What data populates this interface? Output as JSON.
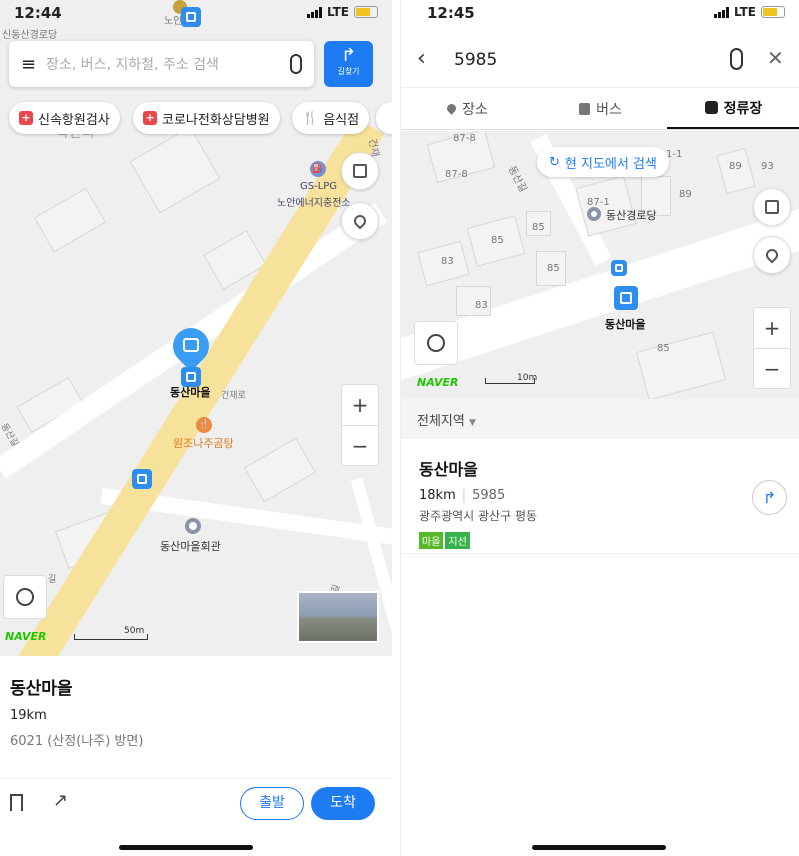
{
  "left": {
    "status": {
      "time": "12:44",
      "network": "LTE"
    },
    "search": {
      "placeholder": "장소, 버스, 지하철, 주소 검색",
      "directions_label": "길찾기"
    },
    "chips": [
      "신속항원검사",
      "코로나전화상담병원",
      "음식점"
    ],
    "map_labels": {
      "top_place": "노안",
      "dongsan_hall_top": "신동산경로당",
      "area": "학산리",
      "gas_name": "GS-LPG",
      "gas_sub": "노안에너지충전소",
      "stop": "동산마을",
      "road": "건재로",
      "restaurant": "원조나주곰탕",
      "hall": "동산마을회관",
      "road_side": "학산동산길",
      "road_left": "동산길",
      "road_left2": "길",
      "road_top_right": "건재"
    },
    "naver_logo": "NAVER",
    "scale_label": "50m",
    "card": {
      "title": "동산마을",
      "distance": "19km",
      "direction": "6021 (산정(나주) 방면)"
    },
    "buttons": {
      "depart": "출발",
      "arrive": "도착"
    }
  },
  "right": {
    "status": {
      "time": "12:45",
      "network": "LTE"
    },
    "search": {
      "query": "5985"
    },
    "tabs": [
      "장소",
      "버스",
      "정류장"
    ],
    "active_tab": "정류장",
    "map": {
      "research_button": "현 지도에서 검색",
      "place": "동산경로당",
      "stop": "동산마을",
      "road": "동산길",
      "lot_numbers": [
        "87-8",
        "87-8",
        "87-1",
        "89",
        "89",
        "93",
        "1-1",
        "85",
        "85",
        "85",
        "83",
        "83",
        "85"
      ]
    },
    "naver_logo": "NAVER",
    "scale_label": "10m",
    "region_filter": "전체지역",
    "result": {
      "name": "동산마을",
      "distance": "18km",
      "stop_id": "5985",
      "address": "광주광역시 광산구 평동",
      "tags": [
        "마을",
        "지선"
      ]
    }
  },
  "colors": {
    "accent": "#1e7cf2",
    "bus": "#2e8ef0",
    "road": "#f7e29c",
    "naver": "#1ec800",
    "tag_village": "#55b92a",
    "tag_branch": "#36b24a"
  }
}
